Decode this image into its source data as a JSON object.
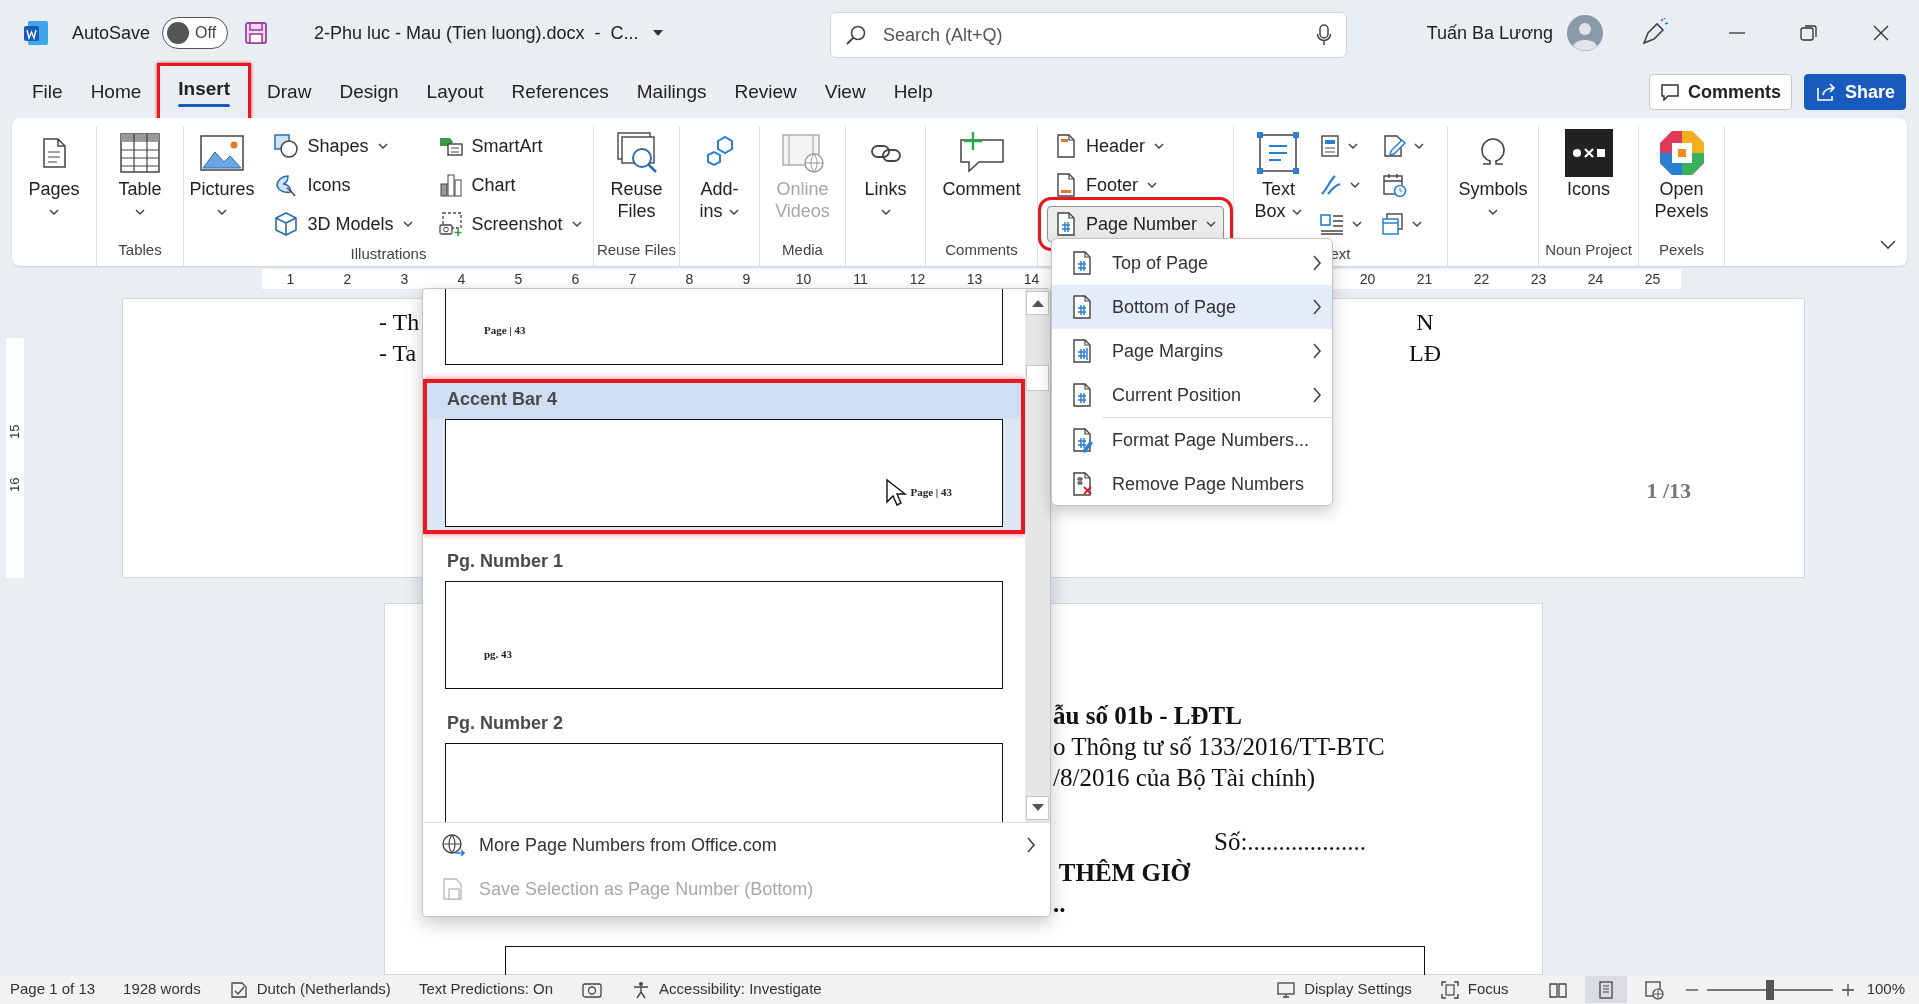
{
  "title_bar": {
    "autosave_label": "AutoSave",
    "autosave": {
      "on": false,
      "label": "Off"
    },
    "document_title": "2-Phu luc - Mau (Tien luong).docx  -  C...",
    "search": {
      "placeholder": "Search (Alt+Q)"
    },
    "user_name": "Tuấn Ba Lương"
  },
  "tabs": [
    {
      "label": "File",
      "selected": false,
      "outlined": false
    },
    {
      "label": "Home",
      "selected": false,
      "outlined": false
    },
    {
      "label": "Insert",
      "selected": true,
      "outlined": true
    },
    {
      "label": "Draw",
      "selected": false,
      "outlined": false
    },
    {
      "label": "Design",
      "selected": false,
      "outlined": false
    },
    {
      "label": "Layout",
      "selected": false,
      "outlined": false
    },
    {
      "label": "References",
      "selected": false,
      "outlined": false
    },
    {
      "label": "Mailings",
      "selected": false,
      "outlined": false
    },
    {
      "label": "Review",
      "selected": false,
      "outlined": false
    },
    {
      "label": "View",
      "selected": false,
      "outlined": false
    },
    {
      "label": "Help",
      "selected": false,
      "outlined": false
    }
  ],
  "header_buttons": [
    {
      "label": "Comments",
      "kind": "outline"
    },
    {
      "label": "Share",
      "kind": "primary"
    }
  ],
  "ribbon": {
    "groups": [
      {
        "items": [
          {
            "kind": "large",
            "lines": [
              "Pages"
            ],
            "caret": true
          }
        ]
      },
      {
        "label": "Tables",
        "items": [
          {
            "kind": "large",
            "lines": [
              "Table"
            ],
            "caret": true
          }
        ]
      },
      {
        "label": "Illustrations",
        "items": [
          {
            "kind": "large",
            "lines": [
              "Pictures"
            ],
            "caret": true
          },
          {
            "kind": "stack",
            "rows": [
              {
                "label": "Shapes",
                "caret": true
              },
              {
                "label": "Icons",
                "caret": false
              },
              {
                "label": "3D Models",
                "caret": true
              }
            ]
          },
          {
            "kind": "stack",
            "rows": [
              {
                "label": "SmartArt",
                "caret": false
              },
              {
                "label": "Chart",
                "caret": false
              },
              {
                "label": "Screenshot",
                "caret": true
              }
            ]
          }
        ]
      },
      {
        "label": "Reuse Files",
        "items": [
          {
            "kind": "large",
            "lines": [
              "Reuse",
              "Files"
            ],
            "caret": false
          }
        ]
      },
      {
        "items": [
          {
            "kind": "large",
            "lines": [
              "Add-",
              "ins"
            ],
            "caret": true
          }
        ]
      },
      {
        "label": "Media",
        "items": [
          {
            "kind": "large",
            "lines": [
              "Online",
              "Videos"
            ],
            "caret": false,
            "disabled": true
          }
        ]
      },
      {
        "items": [
          {
            "kind": "large",
            "lines": [
              "Links"
            ],
            "caret": true
          }
        ]
      },
      {
        "label": "Comments",
        "items": [
          {
            "kind": "large",
            "lines": [
              "Comment"
            ],
            "caret": false
          }
        ]
      },
      {
        "items": [
          {
            "kind": "stack",
            "rows": [
              {
                "label": "Header",
                "caret": true,
                "pressed": false,
                "outlined": false
              },
              {
                "label": "Footer",
                "caret": true,
                "pressed": false,
                "outlined": false
              },
              {
                "label": "Page Number",
                "caret": true,
                "pressed": true,
                "outlined": true
              }
            ]
          }
        ]
      },
      {
        "label": "ext",
        "items": [
          {
            "kind": "large",
            "lines": [
              "Text",
              "Box"
            ],
            "caret": true
          },
          {
            "kind": "icons",
            "rows": [
              {
                "caret": true
              },
              {
                "caret": true
              },
              {
                "caret": true
              }
            ]
          },
          {
            "kind": "icons",
            "rows": [
              {
                "caret": true
              },
              {
                "caret": false
              },
              {
                "caret": true
              }
            ]
          }
        ]
      },
      {
        "items": [
          {
            "kind": "large",
            "lines": [
              "Symbols"
            ],
            "caret": true
          }
        ]
      },
      {
        "label": "Noun Project",
        "items": [
          {
            "kind": "large",
            "lines": [
              "Icons"
            ],
            "caret": false
          }
        ]
      },
      {
        "label": "Pexels",
        "items": [
          {
            "kind": "large",
            "lines": [
              "Open",
              "Pexels"
            ],
            "caret": false
          }
        ]
      }
    ]
  },
  "ruler": {
    "left_labels": [
      "1",
      "2",
      "3",
      "4",
      "5",
      "6",
      "7",
      "8",
      "9",
      "10",
      "11",
      "12",
      "13",
      "14"
    ],
    "right_labels": [
      "20",
      "21",
      "22",
      "23",
      "24",
      "25"
    ]
  },
  "vertical_ruler": {
    "labels": [
      "15",
      "16"
    ]
  },
  "pages": [
    {
      "left_lines": [
        "- Th",
        "- Ta"
      ],
      "right_lines": [
        "N",
        "LĐ"
      ],
      "footer": "1 /13"
    },
    {
      "lines": [
        {
          "kind": "heading",
          "text": "ẫu số 01b - LĐTL"
        },
        {
          "kind": "text",
          "text": "o Thông tư số 133/2016/TT-BTC"
        },
        {
          "kind": "text",
          "text": "/8/2016 của Bộ Tài chính)"
        },
        {
          "kind": "number_field",
          "text": "Số:..................."
        },
        {
          "kind": "heading",
          "text": " THÊM GIỜ"
        },
        {
          "kind": "heading",
          "text": ".."
        }
      ]
    }
  ],
  "gallery": {
    "items": [
      {
        "selected": false,
        "outlined": false,
        "preview": {
          "kind": "left",
          "text": "Page | 43"
        }
      },
      {
        "heading": "Accent Bar 4",
        "selected": true,
        "outlined": true,
        "preview": {
          "kind": "right",
          "text": "Page | 43"
        }
      },
      {
        "heading": "Pg. Number 1",
        "selected": false,
        "outlined": false,
        "preview": {
          "kind": "left",
          "text": "pg. 43"
        }
      },
      {
        "heading": "Pg. Number 2",
        "selected": false,
        "outlined": false
      }
    ],
    "footer_items": [
      {
        "label": "More Page Numbers from Office.com",
        "disabled": false,
        "submenu": true
      },
      {
        "label": "Save Selection as Page Number (Bottom)",
        "disabled": true,
        "submenu": false
      }
    ]
  },
  "submenu": {
    "items": [
      {
        "label": "Top of Page",
        "selected": false,
        "submenu": true,
        "separator_before": false
      },
      {
        "label": "Bottom of Page",
        "selected": true,
        "submenu": true,
        "separator_before": false
      },
      {
        "label": "Page Margins",
        "selected": false,
        "submenu": true,
        "separator_before": false
      },
      {
        "label": "Current Position",
        "selected": false,
        "submenu": true,
        "separator_before": false
      },
      {
        "label": "Format Page Numbers...",
        "selected": false,
        "submenu": false,
        "separator_before": true
      },
      {
        "label": "Remove Page Numbers",
        "selected": false,
        "submenu": false,
        "separator_before": false
      }
    ]
  },
  "status_bar": {
    "page": "Page 1 of 13",
    "words": "1928 words",
    "language": "Dutch (Netherlands)",
    "text_predictions": "Text Predictions: On",
    "accessibility": "Accessibility: Investigate",
    "display_settings": "Display Settings",
    "focus": "Focus",
    "views": [
      {
        "selected": false
      },
      {
        "selected": true
      },
      {
        "selected": false
      }
    ],
    "zoom": {
      "level": 0.5,
      "label": "100%"
    }
  }
}
